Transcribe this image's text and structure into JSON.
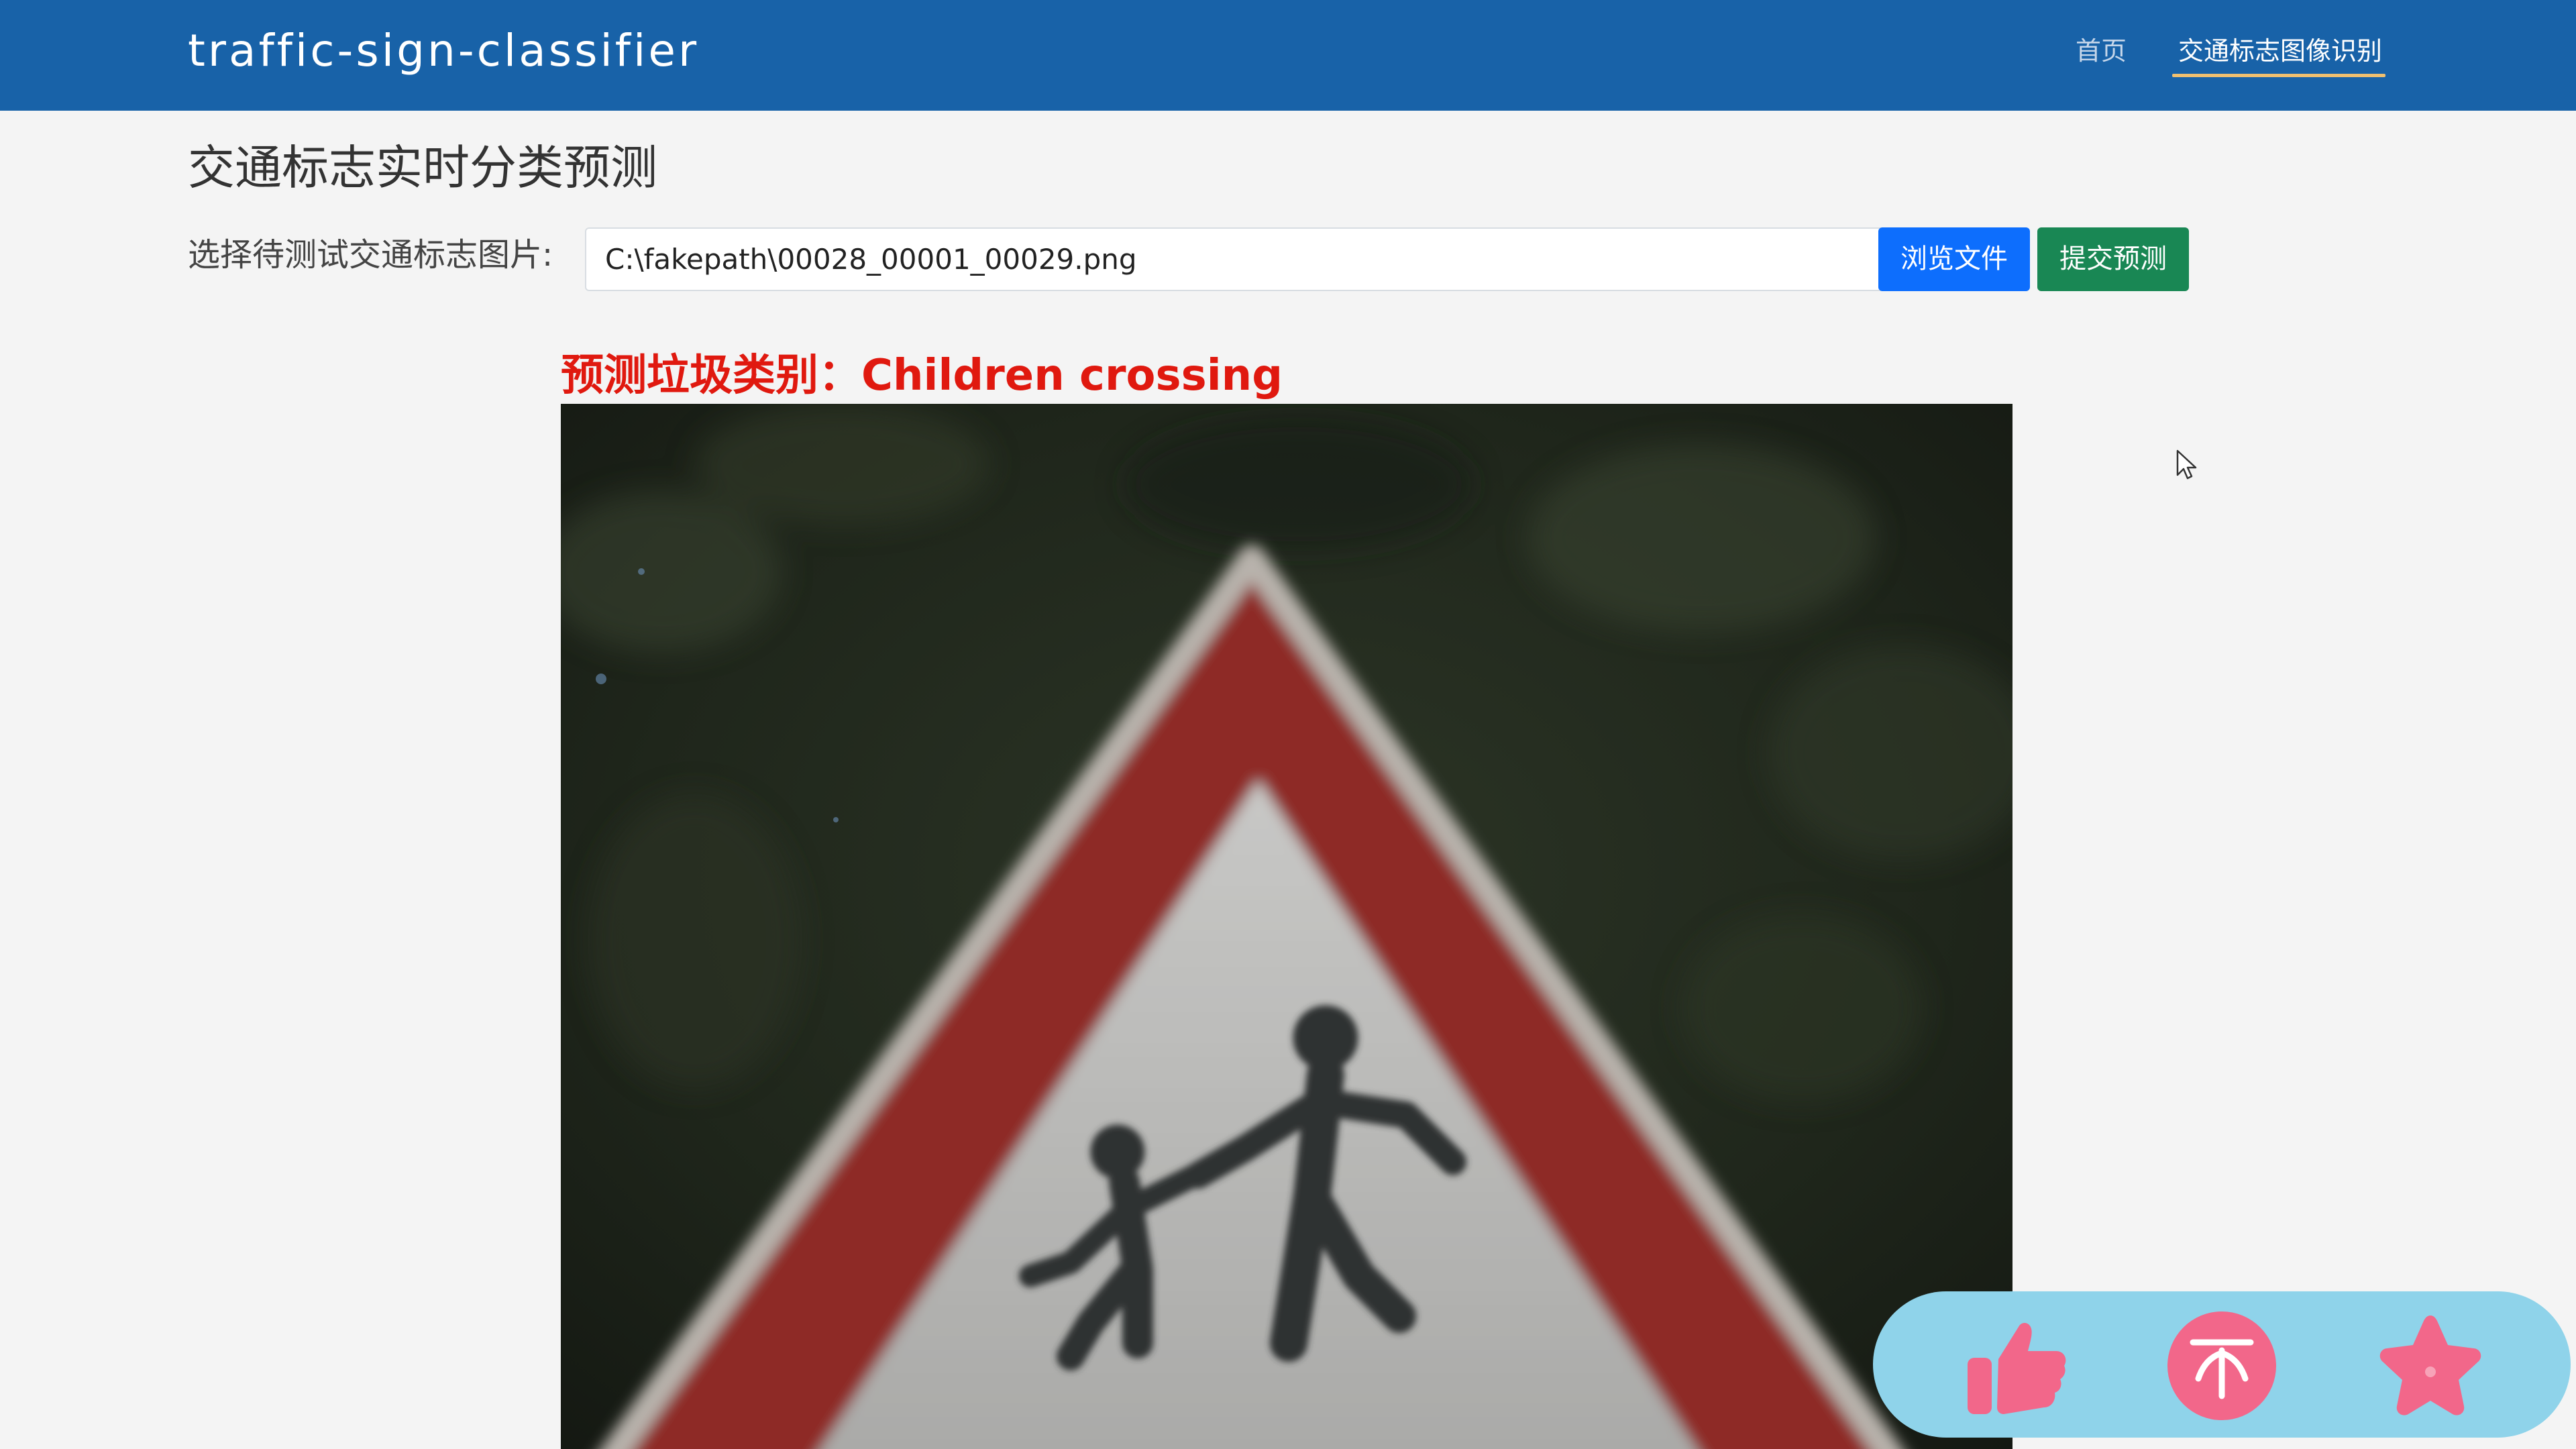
{
  "navbar": {
    "brand": "traffic-sign-classifier",
    "links": [
      {
        "label": "首页",
        "active": false
      },
      {
        "label": "交通标志图像识别",
        "active": true
      }
    ]
  },
  "page": {
    "title": "交通标志实时分类预测"
  },
  "form": {
    "file_label": "选择待测试交通标志图片:",
    "file_value": "C:\\fakepath\\00028_00001_00029.png",
    "browse_label": "浏览文件",
    "submit_label": "提交预测"
  },
  "result": {
    "prefix": "预测垃圾类别：",
    "class_name": "Children crossing"
  },
  "preview": {
    "icon": "traffic-sign-photo",
    "subject": "children-crossing-warning-sign"
  },
  "floating_actions": {
    "items": [
      {
        "icon": "thumbs-up-icon"
      },
      {
        "icon": "back-to-top-icon"
      },
      {
        "icon": "star-icon"
      }
    ],
    "colors": {
      "panel": "#8fd3ea",
      "icon": "#f2678a"
    }
  },
  "colors": {
    "navbar": "#1862a8",
    "result_text": "#e0190f",
    "browse_button": "#0d6efd",
    "submit_button": "#198754"
  }
}
